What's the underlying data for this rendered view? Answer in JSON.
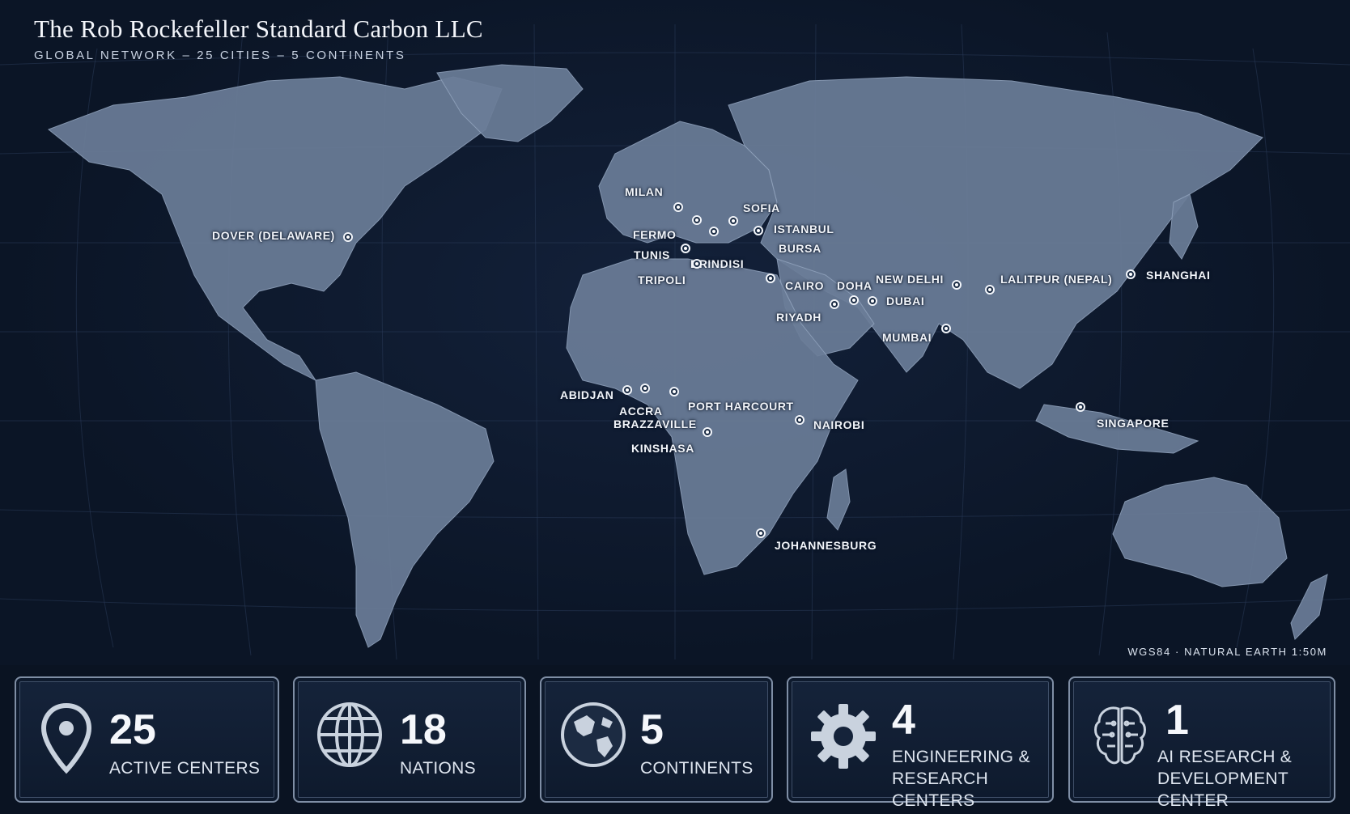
{
  "header": {
    "title": "The Rob Rockefeller Standard Carbon LLC",
    "subtitle": "GLOBAL NETWORK – 25 CITIES – 5 CONTINENTS"
  },
  "projection_note": "WGS84 · NATURAL EARTH 1:50M",
  "cities": [
    {
      "name": "DOVER (DELAWARE)"
    },
    {
      "name": "MILAN"
    },
    {
      "name": "FERMO"
    },
    {
      "name": "TUNIS"
    },
    {
      "name": "BRINDISI"
    },
    {
      "name": "TRIPOLI"
    },
    {
      "name": "SOFIA"
    },
    {
      "name": "ISTANBUL"
    },
    {
      "name": "BURSA"
    },
    {
      "name": "CAIRO"
    },
    {
      "name": "DOHA"
    },
    {
      "name": "DUBAI"
    },
    {
      "name": "RIYADH"
    },
    {
      "name": "NEW DELHI"
    },
    {
      "name": "LALITPUR (NEPAL)"
    },
    {
      "name": "SHANGHAI"
    },
    {
      "name": "MUMBAI"
    },
    {
      "name": "ABIDJAN"
    },
    {
      "name": "ACCRA"
    },
    {
      "name": "PORT HARCOURT"
    },
    {
      "name": "BRAZZAVILLE"
    },
    {
      "name": "KINSHASA"
    },
    {
      "name": "NAIROBI"
    },
    {
      "name": "SINGAPORE"
    },
    {
      "name": "JOHANNESBURG"
    }
  ],
  "stats": [
    {
      "icon": "location-pin-icon",
      "value": "25",
      "label_line1": "ACTIVE CENTERS",
      "label_line2": ""
    },
    {
      "icon": "globe-grid-icon",
      "value": "18",
      "label_line1": "NATIONS",
      "label_line2": ""
    },
    {
      "icon": "earth-icon",
      "value": "5",
      "label_line1": "CONTINENTS",
      "label_line2": ""
    },
    {
      "icon": "gear-icon",
      "value": "4",
      "label_line1": "ENGINEERING &",
      "label_line2": "RESEARCH CENTERS"
    },
    {
      "icon": "brain-circuit-icon",
      "value": "1",
      "label_line1": "AI RESEARCH &",
      "label_line2": "DEVELOPMENT CENTER"
    }
  ],
  "colors": {
    "background": "#0b1526",
    "land": "#6b7d98",
    "marker": "#f2f5fa",
    "card_border": "#7f8ea5"
  }
}
